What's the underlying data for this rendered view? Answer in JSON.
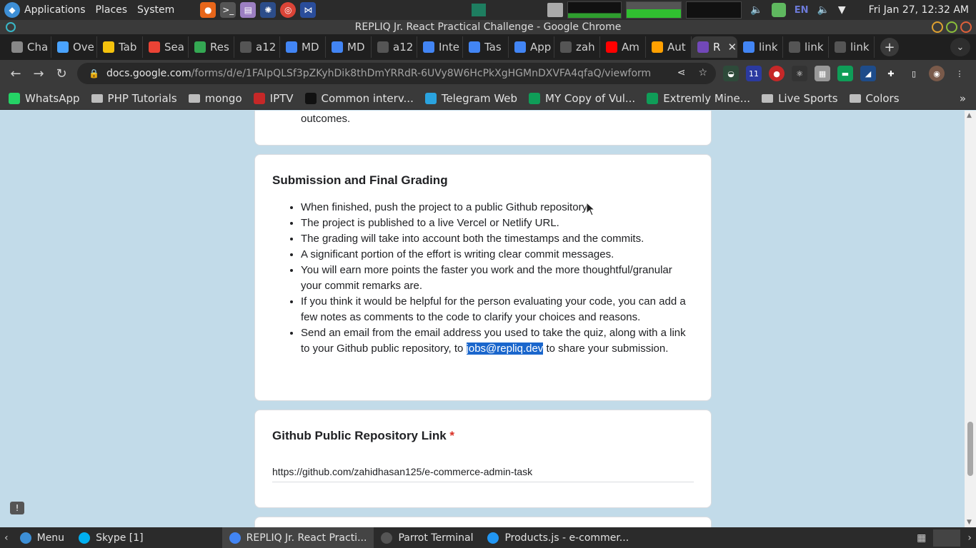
{
  "system_panel": {
    "menus": [
      "Applications",
      "Places",
      "System"
    ],
    "language": "EN",
    "clock": "Fri Jan 27, 12:32 AM"
  },
  "window": {
    "title": "REPLIQ Jr. React Practical Challenge - Google Chrome"
  },
  "tabs": [
    {
      "label": "Cha",
      "color": "#888888",
      "icon": "chat-icon"
    },
    {
      "label": "Ove",
      "color": "#4aa3ff",
      "icon": "wave-icon"
    },
    {
      "label": "Tab",
      "color": "#f4c20d",
      "icon": "flower-icon"
    },
    {
      "label": "Sea",
      "color": "#ea4335",
      "icon": "gmail-icon"
    },
    {
      "label": "Res",
      "color": "#34a853",
      "icon": "drive-icon"
    },
    {
      "label": "a12",
      "color": "#555555",
      "icon": "github-icon"
    },
    {
      "label": "MD",
      "color": "#4285f4",
      "icon": "docs-icon"
    },
    {
      "label": "MD",
      "color": "#4285f4",
      "icon": "docs-icon"
    },
    {
      "label": "a12",
      "color": "#555555",
      "icon": "github-icon"
    },
    {
      "label": "Inte",
      "color": "#4285f4",
      "icon": "docs-icon"
    },
    {
      "label": "Tas",
      "color": "#4285f4",
      "icon": "docs-icon"
    },
    {
      "label": "App",
      "color": "#4285f4",
      "icon": "docs-icon"
    },
    {
      "label": "zah",
      "color": "#555555",
      "icon": "github-icon"
    },
    {
      "label": "Am",
      "color": "#ff0000",
      "icon": "youtube-icon"
    },
    {
      "label": "Aut",
      "color": "#ffa000",
      "icon": "firebase-icon"
    },
    {
      "label": "R",
      "color": "#7248b9",
      "icon": "forms-icon",
      "active": true
    },
    {
      "label": "link",
      "color": "#4285f4",
      "icon": "google-icon"
    },
    {
      "label": "link",
      "color": "#555555",
      "icon": "github-icon"
    },
    {
      "label": "link",
      "color": "#555555",
      "icon": "github-icon"
    }
  ],
  "address_bar": {
    "host": "docs.google.com",
    "path": "/forms/d/e/1FAIpQLSf3pZKyhDik8thDmYRRdR-6UVy8W6HcPkXgHGMnDXVFA4qfaQ/viewform"
  },
  "bookmarks": [
    {
      "label": "WhatsApp",
      "icon": "whatsapp-icon",
      "color": "#25d366"
    },
    {
      "label": "PHP Tutorials",
      "icon": "folder-icon"
    },
    {
      "label": "mongo",
      "icon": "folder-icon"
    },
    {
      "label": "IPTV",
      "icon": "iptv-icon",
      "color": "#c62828"
    },
    {
      "label": "Common interv...",
      "icon": "dev-icon",
      "color": "#111111"
    },
    {
      "label": "Telegram Web",
      "icon": "telegram-icon",
      "color": "#2aa3df"
    },
    {
      "label": "MY Copy of Vul...",
      "icon": "sheets-icon",
      "color": "#0f9d58"
    },
    {
      "label": "Extremly Mine...",
      "icon": "sheets-icon",
      "color": "#0f9d58"
    },
    {
      "label": "Live Sports",
      "icon": "folder-icon"
    },
    {
      "label": "Colors",
      "icon": "folder-icon"
    }
  ],
  "form": {
    "prev_card_tail": "outcomes.",
    "submission": {
      "heading": "Submission and Final Grading",
      "bullets": [
        "When finished, push the project to a public Github repository.",
        "The project is published to a live Vercel or Netlify URL.",
        "The grading will take into account both the timestamps and the commits.",
        "A significant portion of the effort is writing clear commit messages.",
        "You will earn more points the faster you work and the more thoughtful/granular your commit remarks are.",
        "If you think it would be helpful for the person evaluating your code, you can add a few notes as comments to the code to clarify your choices and reasons."
      ],
      "last_bullet_before": "Send an email from the email address you used to take the quiz, along with a link to your Github public repository, to ",
      "last_bullet_email": "jobs@repliq.dev",
      "last_bullet_after": " to share your submission."
    },
    "repo": {
      "question": "Github Public Repository Link",
      "required_mark": "*",
      "answer": "https://github.com/zahidhasan125/e-commerce-admin-task"
    }
  },
  "taskbar": {
    "menu_label": "Menu",
    "items": [
      {
        "label": "Skype [1]",
        "icon": "skype-icon",
        "color": "#00aff0"
      },
      {
        "label": "REPLIQ Jr. React Practi...",
        "icon": "chrome-icon",
        "color": "#4285f4",
        "active": true
      },
      {
        "label": "Parrot Terminal",
        "icon": "terminal-icon",
        "color": "#555555"
      },
      {
        "label": "Products.js - e-commer...",
        "icon": "vscode-icon",
        "color": "#2196f3"
      }
    ]
  }
}
